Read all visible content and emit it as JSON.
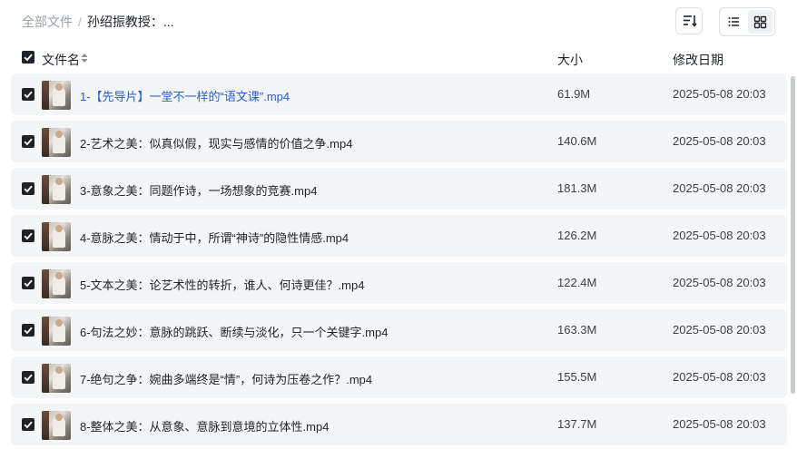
{
  "breadcrumb": {
    "root": "全部文件",
    "separator": "/",
    "current": "孙绍振教授：..."
  },
  "toolbar": {
    "sort_icon": "sort-descending-icon",
    "list_view_icon": "list-view-icon",
    "grid_view_icon": "grid-view-icon"
  },
  "table": {
    "columns": {
      "name": "文件名",
      "size": "大小",
      "date": "修改日期"
    },
    "rows": [
      {
        "name": "1-【先导片】一堂不一样的“语文课”.mp4",
        "size": "61.9M",
        "date": "2025-05-08 20:03"
      },
      {
        "name": "2-艺术之美：似真似假，现实与感情的价值之争.mp4",
        "size": "140.6M",
        "date": "2025-05-08 20:03"
      },
      {
        "name": "3-意象之美：同题作诗，一场想象的竞赛.mp4",
        "size": "181.3M",
        "date": "2025-05-08 20:03"
      },
      {
        "name": "4-意脉之美：情动于中，所谓“神诗”的隐性情感.mp4",
        "size": "126.2M",
        "date": "2025-05-08 20:03"
      },
      {
        "name": "5-文本之美：论艺术性的转折，谁人、何诗更佳？.mp4",
        "size": "122.4M",
        "date": "2025-05-08 20:03"
      },
      {
        "name": "6-句法之妙：意脉的跳跃、断续与淡化，只一个关键字.mp4",
        "size": "163.3M",
        "date": "2025-05-08 20:03"
      },
      {
        "name": "7-绝句之争：婉曲多端终是“情”，何诗为压卷之作？.mp4",
        "size": "155.5M",
        "date": "2025-05-08 20:03"
      },
      {
        "name": "8-整体之美：从意象、意脉到意境的立体性.mp4",
        "size": "137.7M",
        "date": "2025-05-08 20:03"
      }
    ]
  },
  "colors": {
    "link": "#2860c9",
    "row_bg": "#f4f5f6",
    "checkbox": "#1f2329"
  }
}
